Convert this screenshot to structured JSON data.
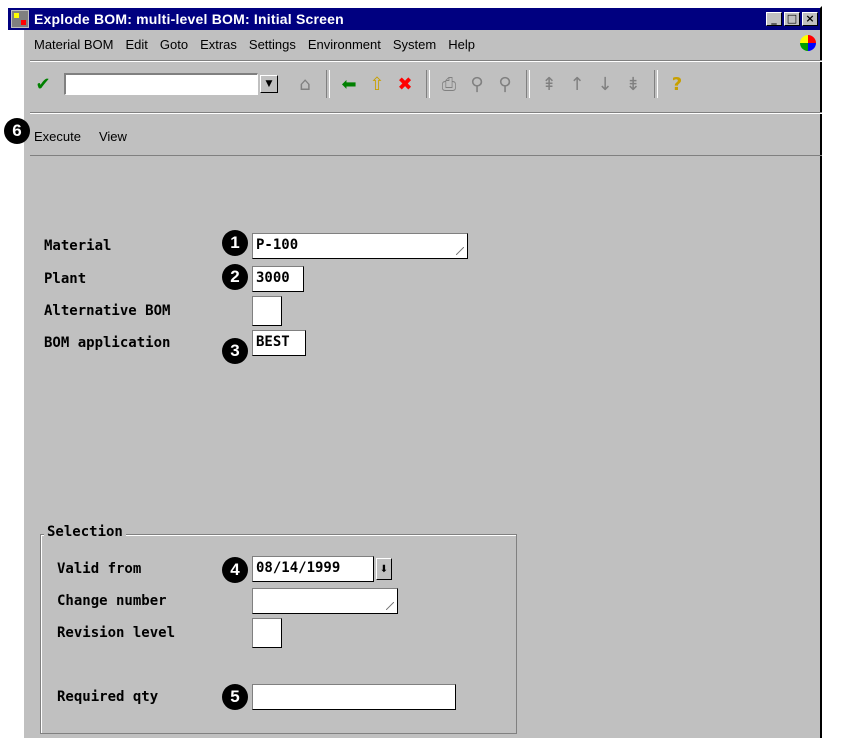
{
  "window": {
    "title": "Explode BOM: multi-level BOM: Initial Screen",
    "controls": [
      "_",
      "□",
      "×"
    ]
  },
  "menu": [
    "Material BOM",
    "Edit",
    "Goto",
    "Extras",
    "Settings",
    "Environment",
    "System",
    "Help"
  ],
  "toolbar": {
    "icons": [
      "enter-check-icon",
      "save-icon",
      "back-icon",
      "exit-icon",
      "cancel-icon",
      "print-icon",
      "find-icon",
      "find-next-icon",
      "first-page-icon",
      "previous-page-icon",
      "next-page-icon",
      "last-page-icon",
      "help-icon"
    ],
    "command_value": ""
  },
  "app_toolbar": {
    "execute": "Execute",
    "view": "View"
  },
  "form": {
    "material_label": "Material",
    "material_value": "P-100",
    "plant_label": "Plant",
    "plant_value": "3000",
    "alt_bom_label": "Alternative BOM",
    "alt_bom_value": "",
    "bom_app_label": "BOM application",
    "bom_app_value": "BEST"
  },
  "selection": {
    "title": "Selection",
    "valid_from_label": "Valid from",
    "valid_from_value": "08/14/1999",
    "change_number_label": "Change number",
    "change_number_value": "",
    "revision_label": "Revision level",
    "revision_value": "",
    "required_qty_label": "Required qty",
    "required_qty_value": ""
  },
  "callouts": {
    "c1": "1",
    "c2": "2",
    "c3": "3",
    "c4": "4",
    "c5": "5",
    "c6": "6"
  },
  "colors": {
    "title_bg": "#000080",
    "window_bg": "#c0c0c0",
    "check_green": "#008000",
    "cancel_red": "#ff0000",
    "help_yellow": "#ffff00"
  }
}
